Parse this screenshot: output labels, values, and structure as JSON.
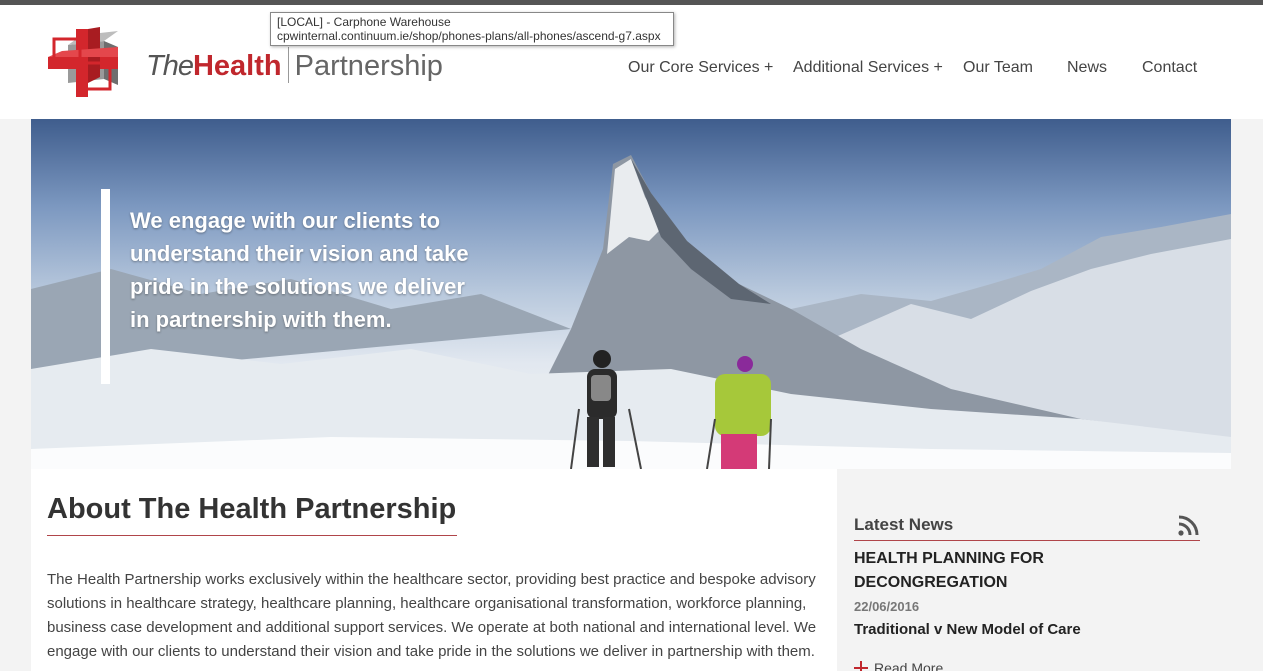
{
  "tooltip": {
    "title": "[LOCAL] - Carphone Warehouse",
    "url": "cpwinternal.continuum.ie/shop/phones-plans/all-phones/ascend-g7.aspx"
  },
  "logo": {
    "the": "The",
    "health": "Health",
    "partnership": "Partnership"
  },
  "nav": {
    "items": [
      {
        "label": "Our Core Services +"
      },
      {
        "label": "Additional Services +"
      },
      {
        "label": "Our Team"
      },
      {
        "label": "News"
      },
      {
        "label": "Contact"
      }
    ]
  },
  "hero": {
    "text": "We engage with our clients to understand their vision and take pride in the solutions we deliver in partnership with them."
  },
  "about": {
    "title": "About The Health Partnership",
    "body": "The Health Partnership works exclusively within the healthcare sector, providing best practice and bespoke advisory solutions in healthcare strategy, healthcare planning, healthcare organisational transformation, workforce planning, business case development and additional support services. We operate at both national and international level. We engage with our clients to understand their vision and take pride in the solutions we deliver in partnership with them."
  },
  "latest_news": {
    "title": "Latest News",
    "item_title": "HEALTH PLANNING FOR DECONGREGATION",
    "date": "22/06/2016",
    "subtitle": "Traditional v New Model of Care",
    "read_more": "Read More"
  },
  "colors": {
    "brand_red": "#c0272d",
    "rule": "#b0454a"
  },
  "icons": {
    "logo": "logo-cube-icon",
    "rss": "rss-icon",
    "read_more": "plus-icon"
  }
}
